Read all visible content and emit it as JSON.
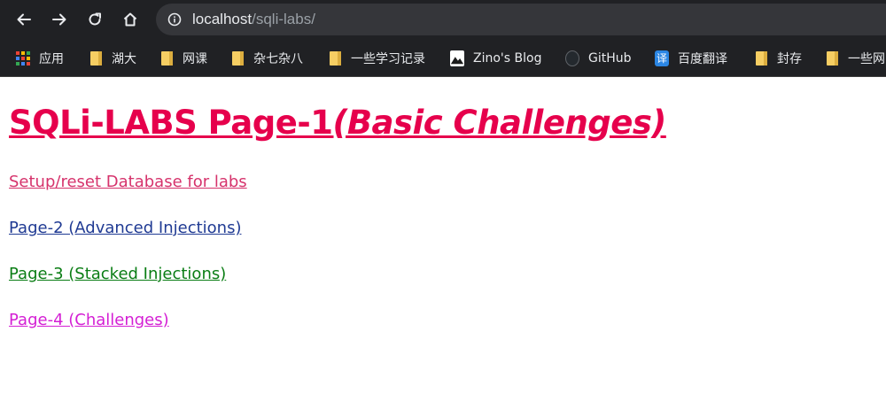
{
  "browser": {
    "url_host": "localhost",
    "url_path": "/sqli-labs/",
    "nav_icons": [
      "back-arrow-icon",
      "forward-arrow-icon",
      "reload-icon",
      "home-icon"
    ]
  },
  "bookmarks": [
    {
      "label": "应用",
      "icon": "apps-grid-icon"
    },
    {
      "label": "湖大",
      "icon": "folder-icon"
    },
    {
      "label": "网课",
      "icon": "folder-icon"
    },
    {
      "label": "杂七杂八",
      "icon": "folder-icon"
    },
    {
      "label": "一些学习记录",
      "icon": "folder-icon"
    },
    {
      "label": "Zino's Blog",
      "icon": "mountain-icon"
    },
    {
      "label": "GitHub",
      "icon": "github-icon"
    },
    {
      "label": "百度翻译",
      "icon": "translate-icon",
      "icon_text": "译"
    },
    {
      "label": "封存",
      "icon": "folder-icon"
    },
    {
      "label": "一些网",
      "icon": "folder-icon"
    }
  ],
  "page": {
    "title_main": "SQLi-LABS Page-1",
    "title_sub": "(Basic Challenges)",
    "links": [
      {
        "label": "Setup/reset Database for labs",
        "color": "#d6336c"
      },
      {
        "label": "Page-2 (Advanced Injections)",
        "color": "#1f3a93"
      },
      {
        "label": "Page-3 (Stacked Injections)",
        "color": "#0a7d14"
      },
      {
        "label": "Page-4 (Challenges)",
        "color": "#d41fd4"
      }
    ]
  }
}
